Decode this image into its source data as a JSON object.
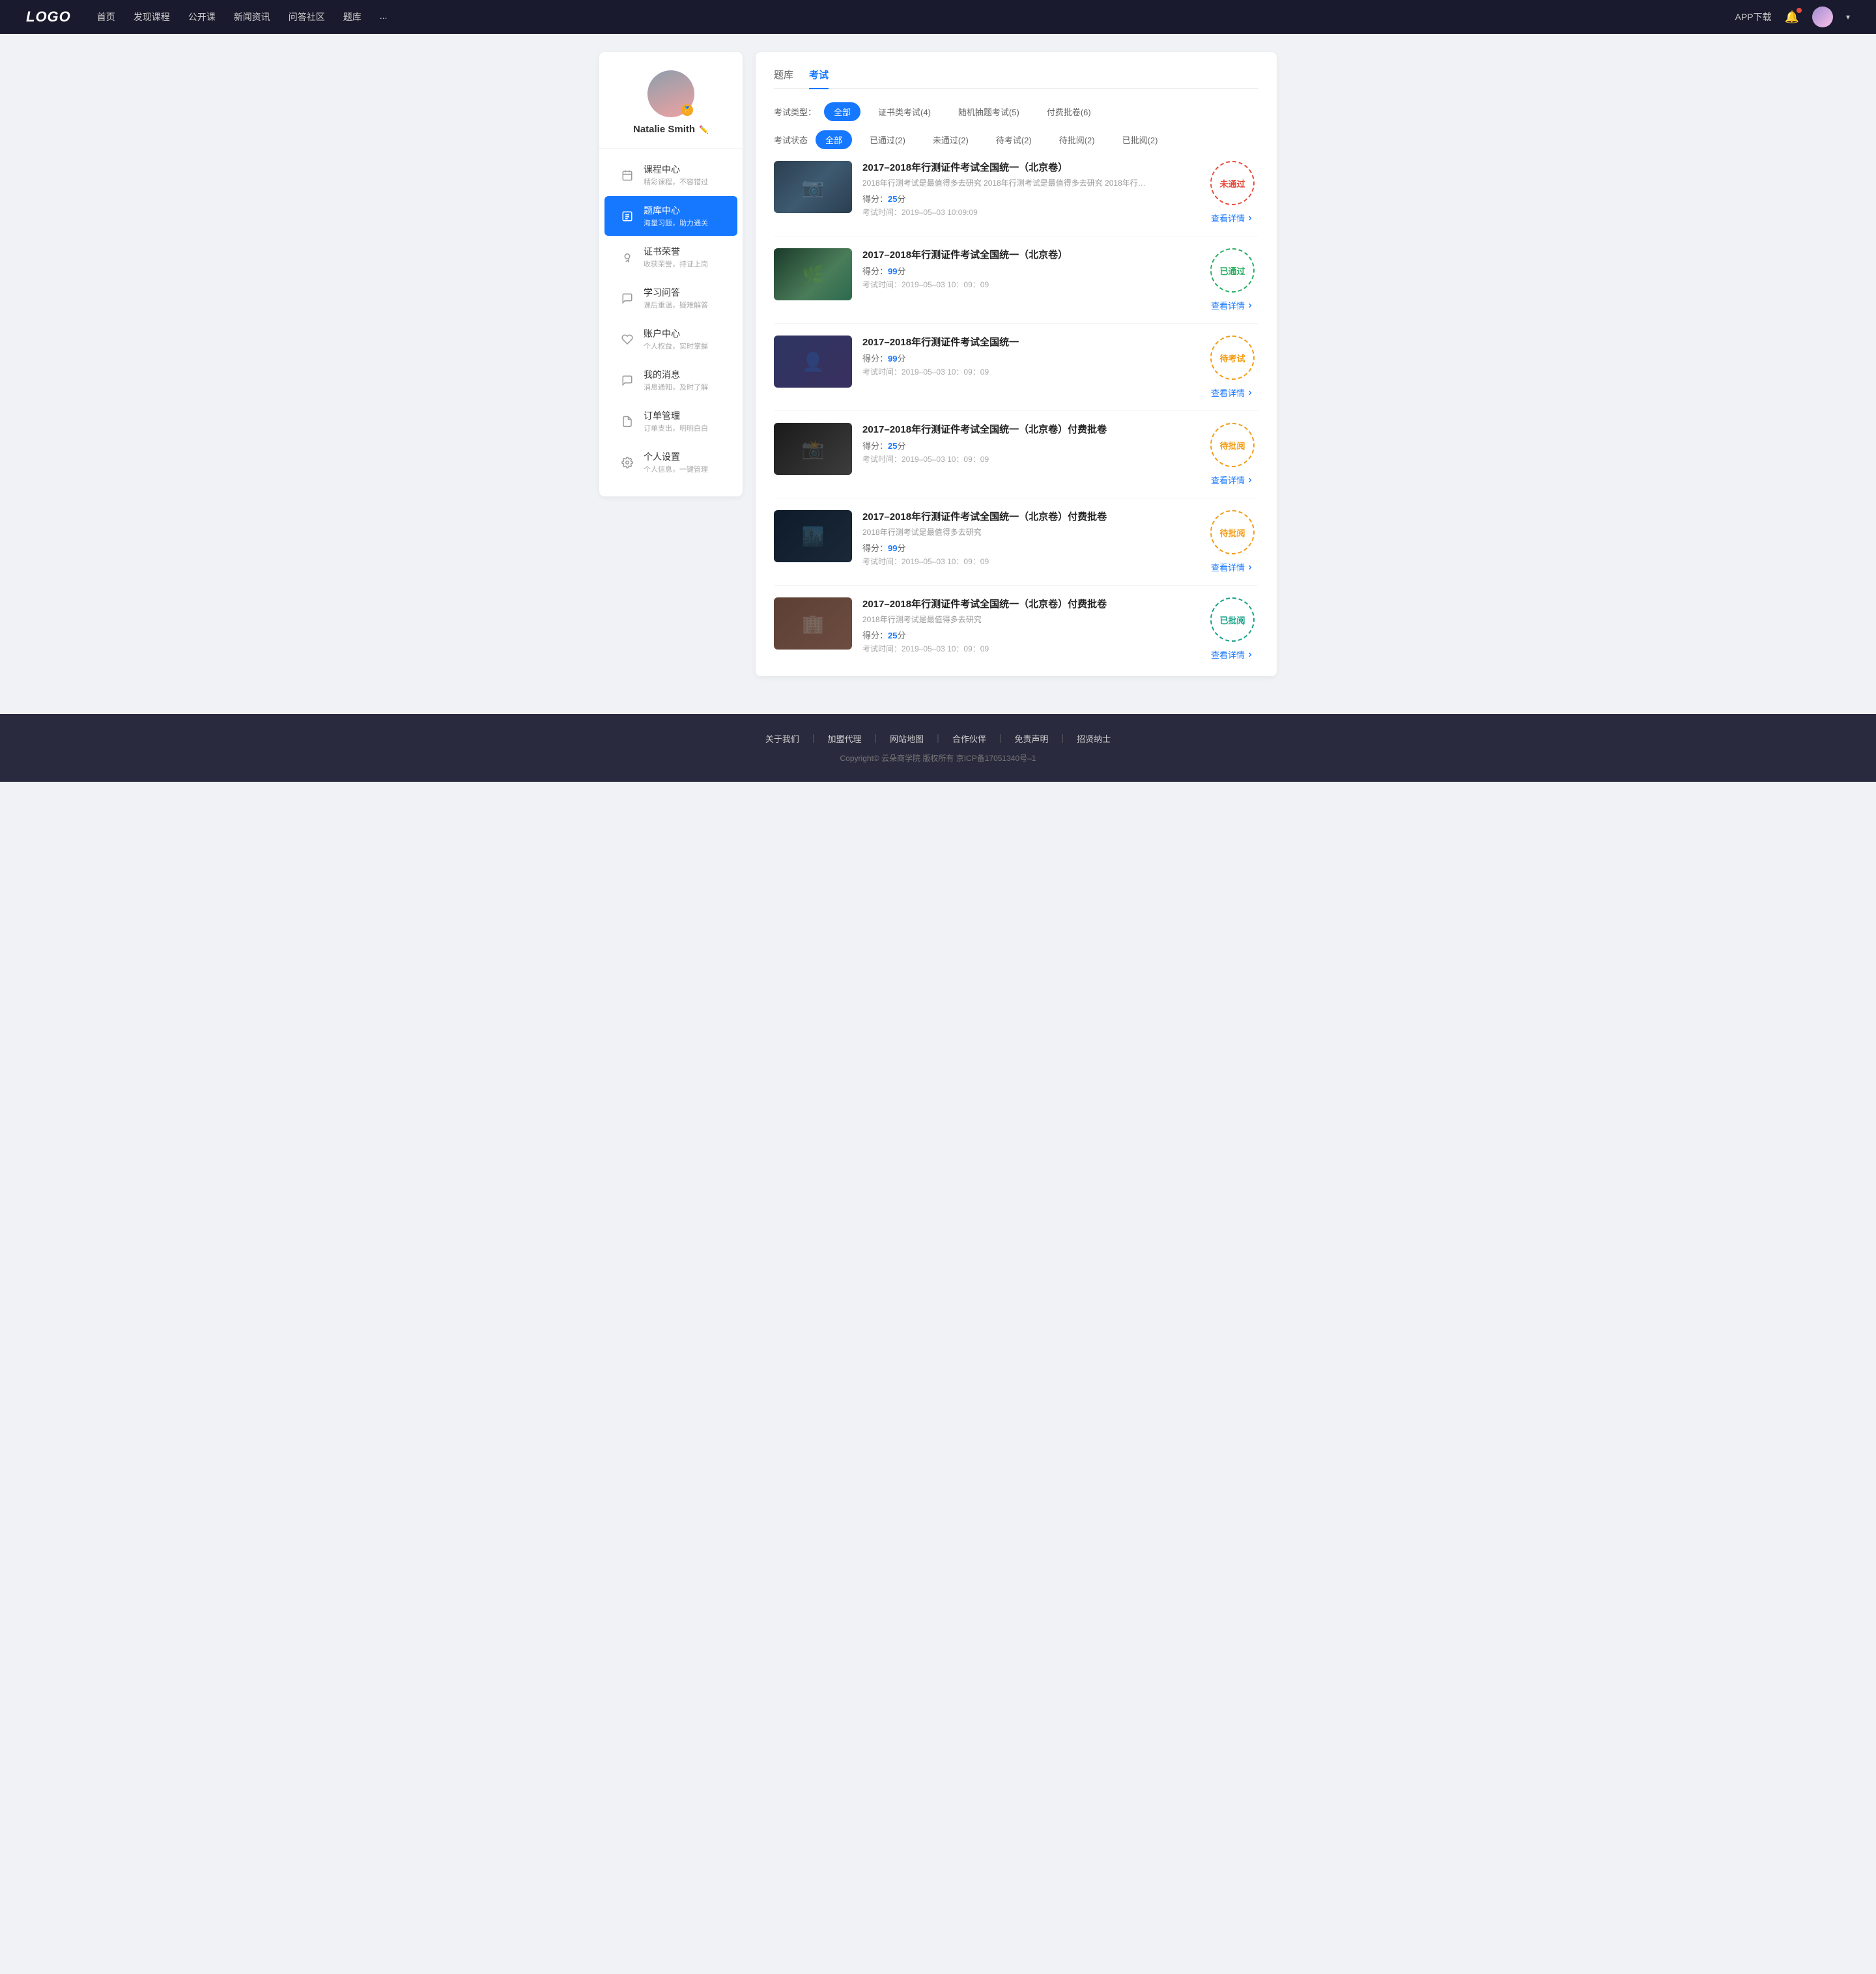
{
  "navbar": {
    "logo": "LOGO",
    "links": [
      "首页",
      "发现课程",
      "公开课",
      "新闻资讯",
      "问答社区",
      "题库",
      "..."
    ],
    "app_btn": "APP下载",
    "dropdown_arrow": "▾"
  },
  "sidebar": {
    "username": "Natalie Smith",
    "badge_icon": "🏅",
    "menu": [
      {
        "id": "course",
        "title": "课程中心",
        "sub": "精彩课程，不容错过",
        "icon": "📅"
      },
      {
        "id": "question",
        "title": "题库中心",
        "sub": "海量习题，助力通关",
        "icon": "📋",
        "active": true
      },
      {
        "id": "cert",
        "title": "证书荣誉",
        "sub": "收获荣誉，持证上岗",
        "icon": "🎓"
      },
      {
        "id": "qa",
        "title": "学习问答",
        "sub": "课后重温，疑难解答",
        "icon": "💬"
      },
      {
        "id": "account",
        "title": "账户中心",
        "sub": "个人权益，实时掌握",
        "icon": "💙"
      },
      {
        "id": "msg",
        "title": "我的消息",
        "sub": "消息通知，及时了解",
        "icon": "💬"
      },
      {
        "id": "order",
        "title": "订单管理",
        "sub": "订单支出，明明白白",
        "icon": "📄"
      },
      {
        "id": "settings",
        "title": "个人设置",
        "sub": "个人信息，一键管理",
        "icon": "⚙️"
      }
    ]
  },
  "content": {
    "tabs": [
      "题库",
      "考试"
    ],
    "active_tab": "考试",
    "type_filter": {
      "label": "考试类型：",
      "options": [
        "全部",
        "证书类考试(4)",
        "随机抽题考试(5)",
        "付费批卷(6)"
      ],
      "active": "全部"
    },
    "status_filter": {
      "label": "考试状态",
      "options": [
        "全部",
        "已通过(2)",
        "未通过(2)",
        "待考试(2)",
        "待批阅(2)",
        "已批阅(2)"
      ],
      "active": "全部"
    },
    "exams": [
      {
        "id": 1,
        "title": "2017–2018年行测证件考试全国统一（北京卷）",
        "desc": "2018年行测考试是最值得多去研究 2018年行测考试是最值得多去研究 2018年行…",
        "score_label": "得分：",
        "score": "25",
        "score_unit": "分",
        "time_label": "考试时间：",
        "time": "2019–05–03  10:09:09",
        "status": "未通过",
        "stamp_class": "stamp-red",
        "detail_link": "查看详情",
        "thumb_class": "thumb-1"
      },
      {
        "id": 2,
        "title": "2017–2018年行测证件考试全国统一（北京卷）",
        "desc": "",
        "score_label": "得分：",
        "score": "99",
        "score_unit": "分",
        "time_label": "考试时间：",
        "time": "2019–05–03  10：09：09",
        "status": "已通过",
        "stamp_class": "stamp-green",
        "detail_link": "查看详情",
        "thumb_class": "thumb-2"
      },
      {
        "id": 3,
        "title": "2017–2018年行测证件考试全国统一",
        "desc": "",
        "score_label": "得分：",
        "score": "99",
        "score_unit": "分",
        "time_label": "考试时间：",
        "time": "2019–05–03  10：09：09",
        "status": "待考试",
        "stamp_class": "stamp-orange",
        "detail_link": "查看详情",
        "thumb_class": "thumb-3"
      },
      {
        "id": 4,
        "title": "2017–2018年行测证件考试全国统一（北京卷）付费批卷",
        "desc": "",
        "score_label": "得分：",
        "score": "25",
        "score_unit": "分",
        "time_label": "考试时间：",
        "time": "2019–05–03  10：09：09",
        "status": "待批阅",
        "stamp_class": "stamp-orange",
        "detail_link": "查看详情",
        "thumb_class": "thumb-4"
      },
      {
        "id": 5,
        "title": "2017–2018年行测证件考试全国统一（北京卷）付费批卷",
        "desc": "2018年行测考试是最值得多去研究",
        "score_label": "得分：",
        "score": "99",
        "score_unit": "分",
        "time_label": "考试时间：",
        "time": "2019–05–03  10：09：09",
        "status": "待批阅",
        "stamp_class": "stamp-orange",
        "detail_link": "查看详情",
        "thumb_class": "thumb-5"
      },
      {
        "id": 6,
        "title": "2017–2018年行测证件考试全国统一（北京卷）付费批卷",
        "desc": "2018年行测考试是最值得多去研究",
        "score_label": "得分：",
        "score": "25",
        "score_unit": "分",
        "time_label": "考试时间：",
        "time": "2019–05–03  10：09：09",
        "status": "已批阅",
        "stamp_class": "stamp-teal",
        "detail_link": "查看详情",
        "thumb_class": "thumb-6"
      }
    ]
  },
  "footer": {
    "links": [
      "关于我们",
      "加盟代理",
      "网站地图",
      "合作伙伴",
      "免责声明",
      "招贤纳士"
    ],
    "copyright": "Copyright© 云朵商学院  版权所有    京ICP备17051340号–1"
  }
}
